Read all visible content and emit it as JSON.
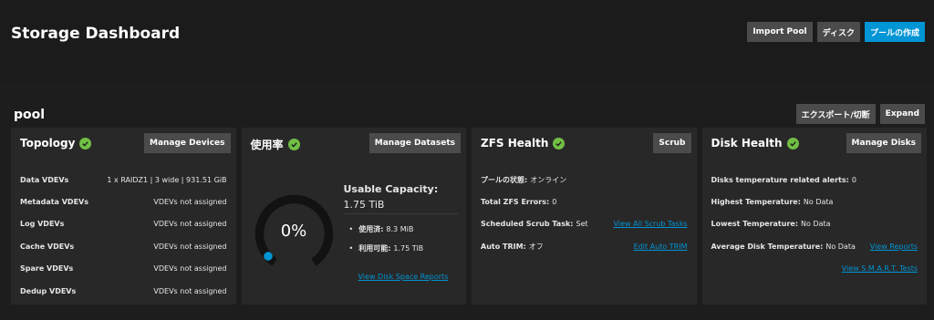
{
  "header": {
    "title": "Storage Dashboard",
    "import_pool": "Import Pool",
    "disks": "ディスク",
    "create_pool": "プールの作成"
  },
  "pool": {
    "name": "pool",
    "export": "エクスポート/切断",
    "expand": "Expand"
  },
  "topology": {
    "title": "Topology",
    "button": "Manage Devices",
    "rows": [
      {
        "label": "Data VDEVs",
        "value": "1 x RAIDZ1 | 3 wide | 931.51 GiB"
      },
      {
        "label": "Metadata VDEVs",
        "value": "VDEVs not assigned"
      },
      {
        "label": "Log VDEVs",
        "value": "VDEVs not assigned"
      },
      {
        "label": "Cache VDEVs",
        "value": "VDEVs not assigned"
      },
      {
        "label": "Spare VDEVs",
        "value": "VDEVs not assigned"
      },
      {
        "label": "Dedup VDEVs",
        "value": "VDEVs not assigned"
      }
    ]
  },
  "usage": {
    "title": "使用率",
    "button": "Manage Datasets",
    "percent": "0%",
    "percent_value": 0,
    "usable_label": "Usable Capacity:",
    "usable_value": "1.75 TiB",
    "used_label": "使用済:",
    "used_value": "8.3 MiB",
    "available_label": "利用可能:",
    "available_value": "1.75 TiB",
    "link": "View Disk Space Reports"
  },
  "zfs": {
    "title": "ZFS Health",
    "button": "Scrub",
    "pool_state_label": "プールの状態:",
    "pool_state_value": "オンライン",
    "errors_label": "Total ZFS Errors:",
    "errors_value": "0",
    "scrub_label": "Scheduled Scrub Task:",
    "scrub_value": "Set",
    "scrub_link": "View All Scrub Tasks",
    "trim_label": "Auto TRIM:",
    "trim_value": "オフ",
    "trim_link": "Edit Auto TRIM"
  },
  "disk_health": {
    "title": "Disk Health",
    "button": "Manage Disks",
    "alerts_label": "Disks temperature related alerts:",
    "alerts_value": "0",
    "highest_label": "Highest Temperature:",
    "highest_value": "No Data",
    "lowest_label": "Lowest Temperature:",
    "lowest_value": "No Data",
    "average_label": "Average Disk Temperature:",
    "average_value": "No Data",
    "reports_link": "View Reports",
    "smart_link": "View S.M.A.R.T. Tests"
  },
  "colors": {
    "accent": "#0095d5",
    "healthy": "#71bf44",
    "card_bg": "#282828"
  }
}
